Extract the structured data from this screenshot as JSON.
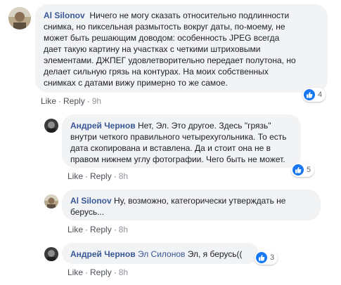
{
  "comments": [
    {
      "author": "Al Silonov",
      "text_lines": [
        "Ничего не могу сказать относительно подлинности",
        "снимка, но пиксельная размытость вокруг даты, по-моему, не",
        "может быть решающим доводом: особенность JPEG всегда",
        "дает такую картину на участках с четкими штриховыми",
        "элементами. ДЖПЕГ удовлетворительно передает полутона, но",
        "делает сильную грязь на контурах. На моих собственных",
        "снимках с датами вижу примерно то же самое."
      ],
      "like_label": "Like",
      "reply_label": "Reply",
      "time": "9h",
      "reactions": "4"
    },
    {
      "author": "Андрей Чернов",
      "text_first": "Нет, Эл. Это другое. Здесь \"грязь\"",
      "text_lines": [
        "внутри четкого правильного четырехугольника. То есть",
        "дата скопирована и вставлена. Да и стоит она не в",
        "правом нижнем углу фотографии. Чего быть не может."
      ],
      "like_label": "Like",
      "reply_label": "Reply",
      "time": "8h",
      "reactions": "5"
    },
    {
      "author": "Al Silonov",
      "text_first": "Ну, возможно, категорически утверждать не",
      "text_lines": [
        "берусь..."
      ],
      "like_label": "Like",
      "reply_label": "Reply",
      "time": "8h"
    },
    {
      "author": "Андрей Чернов",
      "mention": "Эл Силонов",
      "text_first": "Эл, я берусь((",
      "like_label": "Like",
      "reply_label": "Reply",
      "time": "8h",
      "reactions": "3"
    }
  ],
  "separator": "·",
  "colors": {
    "link": "#385898",
    "bubble": "#f2f3f5",
    "like_badge": "#1877f2"
  },
  "icons": {
    "reaction": "thumbs-up-icon"
  }
}
